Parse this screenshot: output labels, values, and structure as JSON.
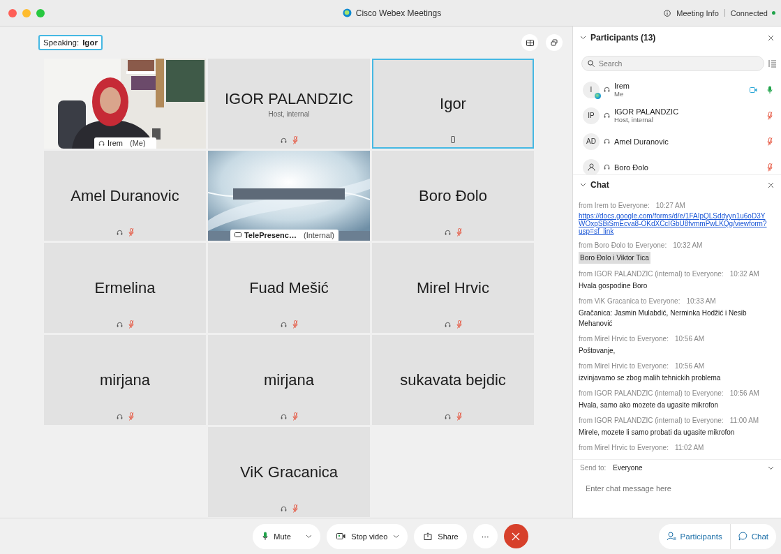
{
  "window": {
    "title": "Cisco Webex Meetings",
    "meeting_info": "Meeting Info",
    "connection": "Connected"
  },
  "speaking": {
    "label": "Speaking:",
    "name": "Igor"
  },
  "tiles": [
    {
      "kind": "video",
      "name": "Irem",
      "note": "(Me)",
      "selected": false
    },
    {
      "kind": "name",
      "name": "IGOR PALANDZIC",
      "subtitle": "Host, internal",
      "muted": true,
      "phone": false,
      "selected": false
    },
    {
      "kind": "name",
      "name": "Igor",
      "phone": true,
      "selected": true
    },
    {
      "kind": "name",
      "name": "Amel Duranovic",
      "muted": true,
      "phone": false,
      "selected": false
    },
    {
      "kind": "telepresence",
      "name": "TelePresenc…",
      "note": "(Internal)",
      "selected": false
    },
    {
      "kind": "name",
      "name": "Boro Đolo",
      "muted": true,
      "phone": false,
      "selected": false
    },
    {
      "kind": "name",
      "name": "Ermelina",
      "muted": true,
      "phone": false,
      "selected": false
    },
    {
      "kind": "name",
      "name": "Fuad Mešić",
      "muted": true,
      "phone": false,
      "selected": false
    },
    {
      "kind": "name",
      "name": "Mirel Hrvic",
      "muted": true,
      "phone": false,
      "selected": false
    },
    {
      "kind": "name",
      "name": "mirjana",
      "muted": true,
      "phone": false,
      "selected": false
    },
    {
      "kind": "name",
      "name": "mirjana",
      "muted": true,
      "phone": false,
      "selected": false
    },
    {
      "kind": "name",
      "name": "sukavata bejdic",
      "muted": true,
      "phone": false,
      "selected": false
    },
    {
      "kind": "name",
      "name": "ViK Gracanica",
      "muted": true,
      "phone": false,
      "selected": false
    }
  ],
  "participants": {
    "title": "Participants (13)",
    "search_placeholder": "Search",
    "people": [
      {
        "avatar": "I",
        "badge": true,
        "name": "Irem",
        "subtitle": "Me",
        "video": true,
        "muted": false
      },
      {
        "avatar": "IP",
        "badge": false,
        "name": "IGOR PALANDZIC",
        "subtitle": "Host, internal",
        "video": false,
        "muted": true
      },
      {
        "avatar": "AD",
        "badge": false,
        "name": "Amel Duranovic",
        "video": false,
        "muted": true
      },
      {
        "badge": false,
        "name": "Boro Đolo",
        "video": false,
        "muted": true
      }
    ]
  },
  "chat": {
    "title": "Chat",
    "messages": [
      {
        "sender": "from Irem to Everyone:",
        "time": "10:27 AM",
        "kind": "link",
        "text": "https://docs.google.com/forms/d/e/1FAIpQLSddyyn1u6oD3YWOxpSBiSmEcva8-OKdXCcIGbU8fvmmPwLKQg/viewform?usp=sf_link"
      },
      {
        "sender": "from Boro Đolo to Everyone:",
        "time": "10:32 AM",
        "kind": "highlight",
        "text": "Boro Đolo i Viktor Tica"
      },
      {
        "sender": "from IGOR PALANDZIC (internal) to Everyone:",
        "time": "10:32 AM",
        "kind": "text",
        "text": "Hvala gospodine Boro"
      },
      {
        "sender": "from ViK Gracanica to Everyone:",
        "time": "10:33 AM",
        "kind": "text",
        "text": "Gračanica: Jasmin Mulabdić, Nerminka Hodžić i Nesib Mehanović"
      },
      {
        "sender": "from Mirel Hrvic to Everyone:",
        "time": "10:56 AM",
        "kind": "text",
        "text": "Poštovanje,"
      },
      {
        "sender": "from Mirel Hrvic to Everyone:",
        "time": "10:56 AM",
        "kind": "text",
        "text": "izvinjavamo se zbog malih tehnickih problema"
      },
      {
        "sender": "from IGOR PALANDZIC (internal) to Everyone:",
        "time": "10:56 AM",
        "kind": "text",
        "text": "Hvala, samo ako mozete da ugasite mikrofon"
      },
      {
        "sender": "from IGOR PALANDZIC (internal) to Everyone:",
        "time": "11:00 AM",
        "kind": "text",
        "text": "Mirele, mozete li samo probati da ugasite mikrofon"
      },
      {
        "sender": "from Mirel Hrvic to Everyone:",
        "time": "11:02 AM"
      }
    ],
    "send_to_label": "Send to:",
    "send_to": "Everyone",
    "placeholder": "Enter chat message here"
  },
  "controls": {
    "mute": "Mute",
    "stop_video": "Stop video",
    "share": "Share",
    "more": "···",
    "participants": "Participants",
    "chat": "Chat"
  }
}
